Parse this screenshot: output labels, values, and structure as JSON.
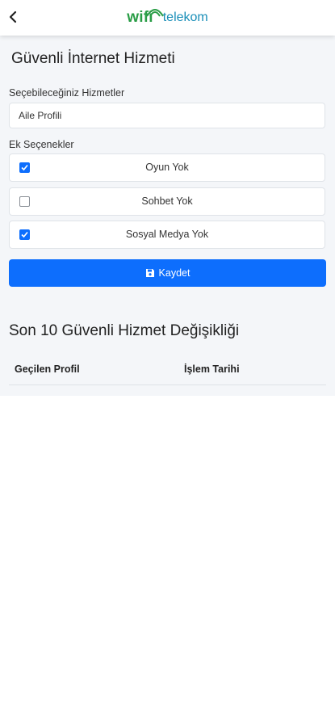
{
  "header": {
    "logo_primary": "wifi",
    "logo_secondary": "telekom",
    "back_icon": "chevron-left-icon",
    "colors": {
      "logo_green": "#2a9d46",
      "logo_blue": "#1a8fb8"
    }
  },
  "page": {
    "title": "Güvenli İnternet Hizmeti",
    "services_label": "Seçebileceğiniz Hizmetler",
    "selected_service": "Aile Profili",
    "options_label": "Ek Seçenekler",
    "options": [
      {
        "label": "Oyun Yok",
        "checked": true
      },
      {
        "label": "Sohbet Yok",
        "checked": false
      },
      {
        "label": "Sosyal Medya Yok",
        "checked": true
      }
    ],
    "save_label": "Kaydet",
    "save_icon": "save-disk-icon",
    "accent": "#0d6efd"
  },
  "history": {
    "title": "Son 10 Güvenli Hizmet Değişikliği",
    "columns": [
      "Geçilen Profil",
      "İşlem Tarihi"
    ],
    "rows": []
  }
}
